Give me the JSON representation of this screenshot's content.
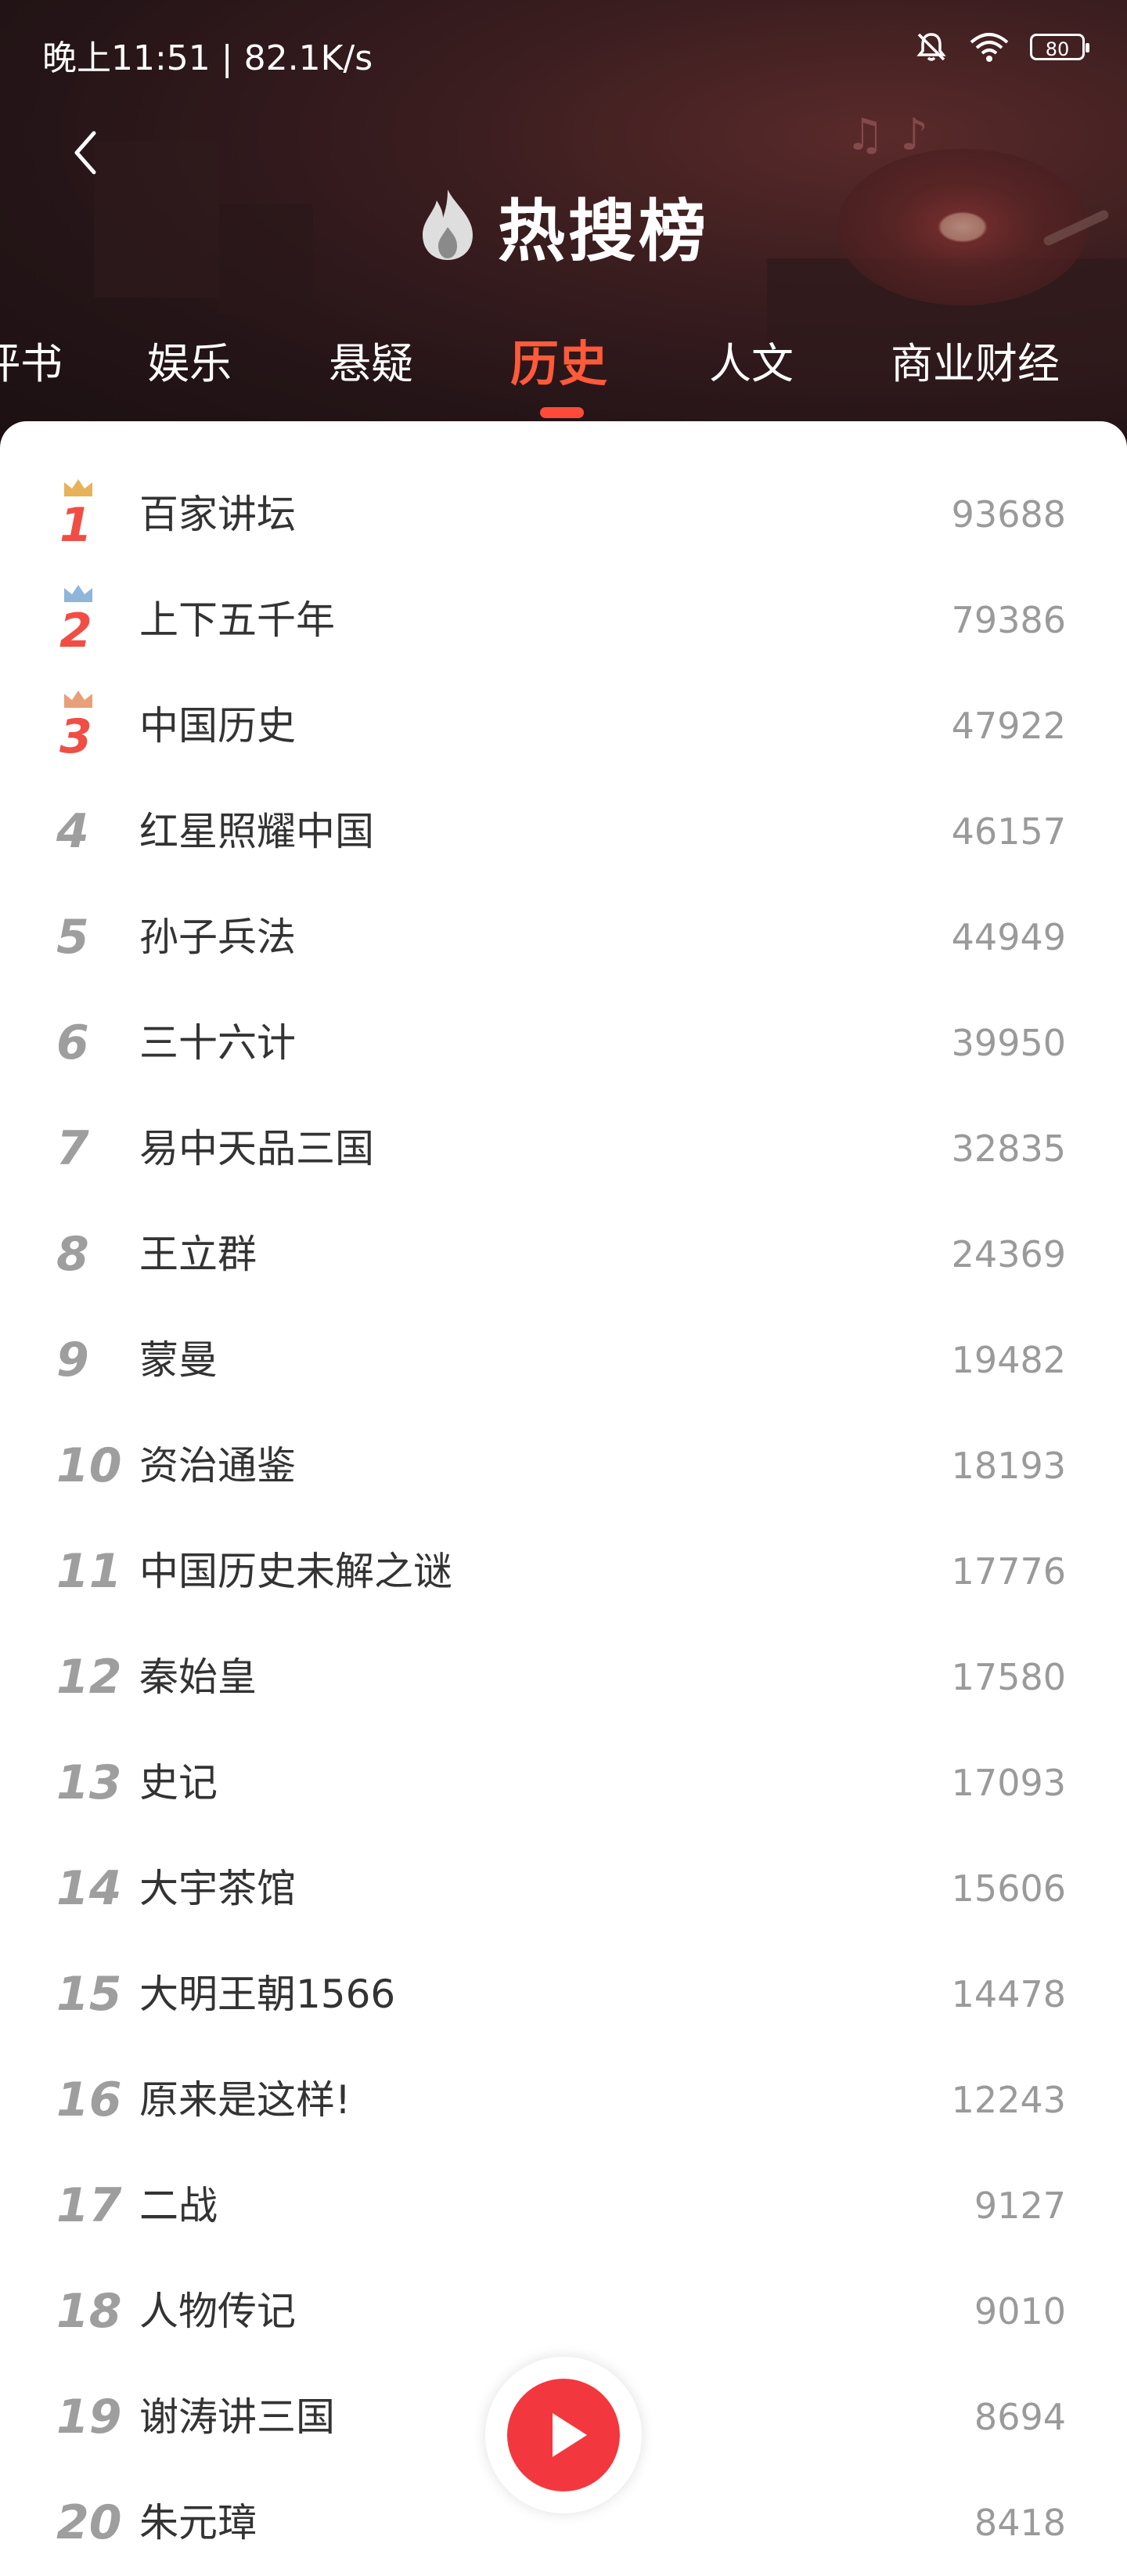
{
  "status_bar": {
    "time_speed": "晚上11:51 | 82.1K/s",
    "battery": "80"
  },
  "header": {
    "title": "热搜榜"
  },
  "tabs": [
    {
      "label": "评书",
      "active": false
    },
    {
      "label": "娱乐",
      "active": false
    },
    {
      "label": "悬疑",
      "active": false
    },
    {
      "label": "历史",
      "active": true
    },
    {
      "label": "人文",
      "active": false
    },
    {
      "label": "商业财经",
      "active": false
    }
  ],
  "colors": {
    "accent": "#ff5a3a",
    "rank_top": "#f04e45",
    "rank_other": "#9e9e9e",
    "play": "#f2383e"
  },
  "list": [
    {
      "rank": "1",
      "name": "百家讲坛",
      "count": "93688"
    },
    {
      "rank": "2",
      "name": "上下五千年",
      "count": "79386"
    },
    {
      "rank": "3",
      "name": "中国历史",
      "count": "47922"
    },
    {
      "rank": "4",
      "name": "红星照耀中国",
      "count": "46157"
    },
    {
      "rank": "5",
      "name": "孙子兵法",
      "count": "44949"
    },
    {
      "rank": "6",
      "name": "三十六计",
      "count": "39950"
    },
    {
      "rank": "7",
      "name": "易中天品三国",
      "count": "32835"
    },
    {
      "rank": "8",
      "name": "王立群",
      "count": "24369"
    },
    {
      "rank": "9",
      "name": "蒙曼",
      "count": "19482"
    },
    {
      "rank": "10",
      "name": "资治通鉴",
      "count": "18193"
    },
    {
      "rank": "11",
      "name": "中国历史未解之谜",
      "count": "17776"
    },
    {
      "rank": "12",
      "name": "秦始皇",
      "count": "17580"
    },
    {
      "rank": "13",
      "name": "史记",
      "count": "17093"
    },
    {
      "rank": "14",
      "name": "大宇茶馆",
      "count": "15606"
    },
    {
      "rank": "15",
      "name": "大明王朝1566",
      "count": "14478"
    },
    {
      "rank": "16",
      "name": "原来是这样!",
      "count": "12243"
    },
    {
      "rank": "17",
      "name": "二战",
      "count": "9127"
    },
    {
      "rank": "18",
      "name": "人物传记",
      "count": "9010"
    },
    {
      "rank": "19",
      "name": "谢涛讲三国",
      "count": "8694"
    },
    {
      "rank": "20",
      "name": "朱元璋",
      "count": "8418"
    }
  ]
}
